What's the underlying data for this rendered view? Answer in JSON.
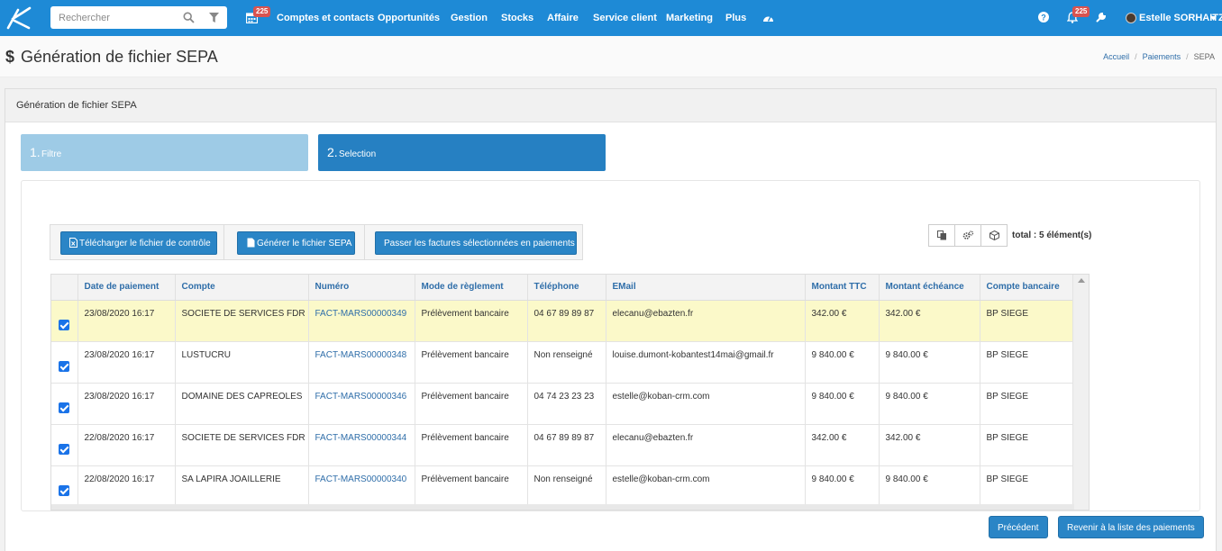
{
  "nav": {
    "search_placeholder": "Rechercher",
    "calendar_badge": "225",
    "items": [
      "Comptes et contacts",
      "Opportunités",
      "Gestion",
      "Stocks",
      "Affaire",
      "Service client",
      "Marketing",
      "Plus"
    ],
    "notif_badge": "225",
    "user_name": "Estelle SORHAITZ",
    "icons": [
      "calendar-icon",
      "dashboard-icon",
      "help-icon",
      "bell-icon",
      "wrench-icon",
      "avatar",
      "caret-down-icon"
    ]
  },
  "page": {
    "title": "Génération de fichier SEPA",
    "title_symbol": "$",
    "breadcrumb": [
      "Accueil",
      "Paiements",
      "SEPA"
    ]
  },
  "panel": {
    "heading": "Génération de fichier SEPA",
    "steps": [
      {
        "num": "1.",
        "label": "Filtre"
      },
      {
        "num": "2.",
        "label": "Selection"
      }
    ]
  },
  "toolbar": {
    "download_control": "Télécharger le fichier de contrôle",
    "generate_sepa": "Générer le fichier SEPA",
    "convert_payments": "Passer les factures sélectionnées en paiements",
    "total": "total : 5 élément(s)"
  },
  "table": {
    "columns": [
      "Date de paiement",
      "Compte",
      "Numéro",
      "Mode de règlement",
      "Téléphone",
      "EMail",
      "Montant TTC",
      "Montant échéance",
      "Compte bancaire"
    ],
    "rows": [
      {
        "checked": true,
        "date": "23/08/2020 16:17",
        "compte": "SOCIETE DE SERVICES FDR",
        "numero": "FACT-MARS00000349",
        "mode": "Prélèvement bancaire",
        "telephone": "04 67 89 89 87",
        "email": "elecanu@ebazten.fr",
        "ttc": "342.00 €",
        "echeance": "342.00 €",
        "banque": "BP SIEGE",
        "highlighted": true
      },
      {
        "checked": true,
        "date": "23/08/2020 16:17",
        "compte": "LUSTUCRU",
        "numero": "FACT-MARS00000348",
        "mode": "Prélèvement bancaire",
        "telephone": "Non renseigné",
        "email": "louise.dumont-kobantest14mai@gmail.fr",
        "ttc": "9 840.00 €",
        "echeance": "9 840.00 €",
        "banque": "BP SIEGE"
      },
      {
        "checked": true,
        "date": "23/08/2020 16:17",
        "compte": "DOMAINE DES CAPREOLES",
        "numero": "FACT-MARS00000346",
        "mode": "Prélèvement bancaire",
        "telephone": "04 74 23 23 23",
        "email": "estelle@koban-crm.com",
        "ttc": "9 840.00 €",
        "echeance": "9 840.00 €",
        "banque": "BP SIEGE"
      },
      {
        "checked": true,
        "date": "22/08/2020 16:17",
        "compte": "SOCIETE DE SERVICES FDR",
        "numero": "FACT-MARS00000344",
        "mode": "Prélèvement bancaire",
        "telephone": "04 67 89 89 87",
        "email": "elecanu@ebazten.fr",
        "ttc": "342.00 €",
        "echeance": "342.00 €",
        "banque": "BP SIEGE"
      },
      {
        "checked": true,
        "date": "22/08/2020 16:17",
        "compte": "SA LAPIRA JOAILLERIE",
        "numero": "FACT-MARS00000340",
        "mode": "Prélèvement bancaire",
        "telephone": "Non renseigné",
        "email": "estelle@koban-crm.com",
        "ttc": "9 840.00 €",
        "echeance": "9 840.00 €",
        "banque": "BP SIEGE"
      }
    ]
  },
  "footer": {
    "previous": "Précédent",
    "back_to_list": "Revenir à la liste des paiements"
  },
  "colors": {
    "topbar": "#1e8ad6",
    "primary_button": "#2a85c6",
    "step_active": "#2680c2",
    "step_inactive": "#9ecbe6",
    "row_highlight": "#fbf9c9",
    "link": "#2f6ea9",
    "badge": "#d9534f"
  }
}
